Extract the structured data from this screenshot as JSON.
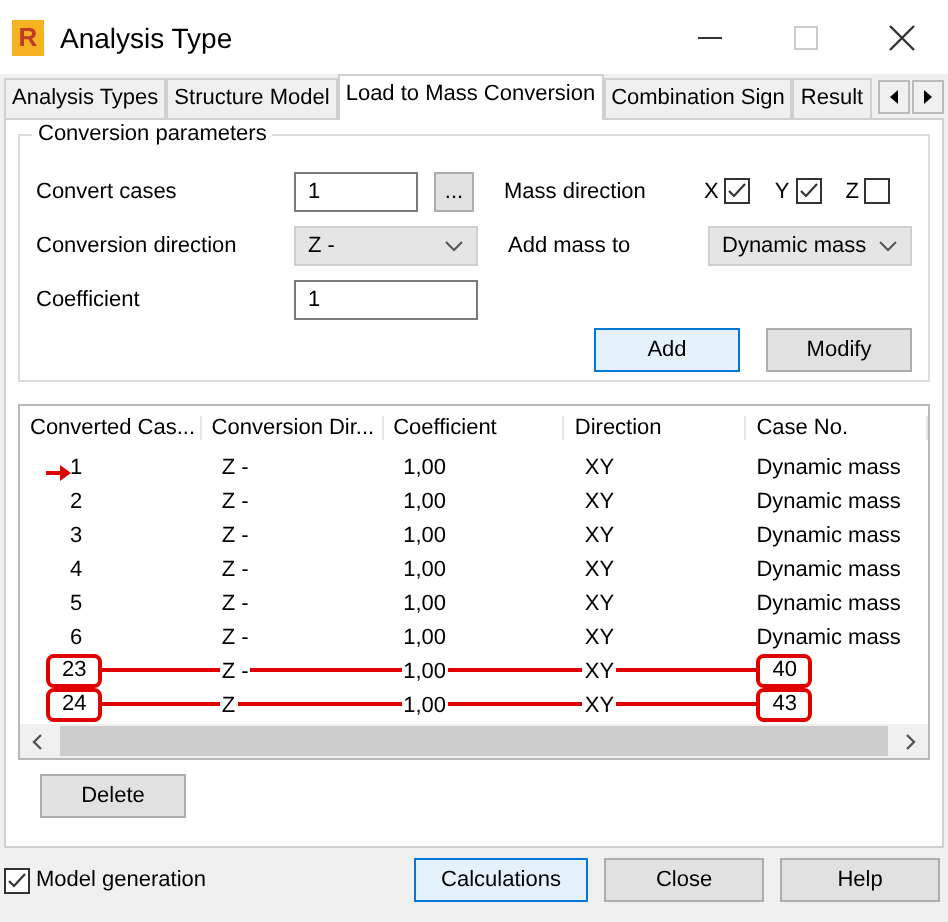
{
  "window": {
    "title": "Analysis Type",
    "icon_letter": "R"
  },
  "tabs": [
    {
      "label": "Analysis Types",
      "selected": false
    },
    {
      "label": "Structure Model",
      "selected": false
    },
    {
      "label": "Load to Mass Conversion",
      "selected": true
    },
    {
      "label": "Combination Sign",
      "selected": false
    },
    {
      "label": "Result",
      "selected": false
    }
  ],
  "group": {
    "title": "Conversion parameters",
    "convert_cases": {
      "label": "Convert cases",
      "value": "1",
      "browse": "..."
    },
    "conversion_direction": {
      "label": "Conversion direction",
      "value": "Z -"
    },
    "coefficient": {
      "label": "Coefficient",
      "value": "1"
    },
    "mass_direction": {
      "label": "Mass direction",
      "axes": [
        {
          "label": "X",
          "checked": true
        },
        {
          "label": "Y",
          "checked": true
        },
        {
          "label": "Z",
          "checked": false
        }
      ]
    },
    "add_mass_to": {
      "label": "Add mass to",
      "value": "Dynamic mass"
    },
    "buttons": [
      {
        "label": "Add",
        "default": true
      },
      {
        "label": "Modify",
        "default": false
      }
    ]
  },
  "table": {
    "columns": [
      "Converted Cas...",
      "Conversion Dir...",
      "Coefficient",
      "Direction",
      "Case No."
    ],
    "rows": [
      {
        "cells": [
          "1",
          "Z -",
          "1,00",
          "XY",
          "Dynamic mass"
        ],
        "current": true,
        "circled": false
      },
      {
        "cells": [
          "2",
          "Z -",
          "1,00",
          "XY",
          "Dynamic mass"
        ],
        "current": false,
        "circled": false
      },
      {
        "cells": [
          "3",
          "Z -",
          "1,00",
          "XY",
          "Dynamic mass"
        ],
        "current": false,
        "circled": false
      },
      {
        "cells": [
          "4",
          "Z -",
          "1,00",
          "XY",
          "Dynamic mass"
        ],
        "current": false,
        "circled": false
      },
      {
        "cells": [
          "5",
          "Z -",
          "1,00",
          "XY",
          "Dynamic mass"
        ],
        "current": false,
        "circled": false
      },
      {
        "cells": [
          "6",
          "Z -",
          "1,00",
          "XY",
          "Dynamic mass"
        ],
        "current": false,
        "circled": false
      },
      {
        "cells": [
          "23",
          "Z -",
          "1,00",
          "XY",
          "40"
        ],
        "current": false,
        "circled": true
      },
      {
        "cells": [
          "24",
          "Z",
          "1,00",
          "XY",
          "43"
        ],
        "current": false,
        "circled": true
      }
    ]
  },
  "delete_button": "Delete",
  "footer": {
    "model_generation": {
      "label": "Model generation",
      "checked": true
    },
    "buttons": [
      {
        "label": "Calculations",
        "default": true
      },
      {
        "label": "Close",
        "default": false
      },
      {
        "label": "Help",
        "default": false
      }
    ]
  }
}
